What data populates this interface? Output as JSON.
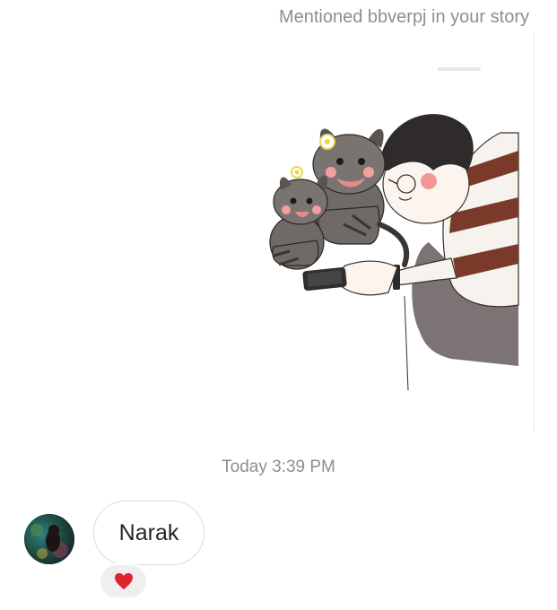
{
  "story_mention": {
    "text": "Mentioned bbverpj in your story"
  },
  "story_card": {
    "illustration": "boy-with-phone-and-two-cats"
  },
  "timestamp": {
    "text": "Today 3:39 PM"
  },
  "message": {
    "text": "Narak",
    "reaction": "heart"
  },
  "colors": {
    "meta_text": "#8e8e8e",
    "bubble_border": "#dbdbdb",
    "reaction_bg": "#efefef",
    "heart": "#e0242f"
  }
}
